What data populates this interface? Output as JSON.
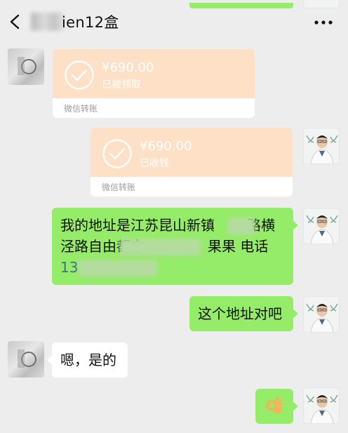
{
  "header": {
    "back_icon": "chevron-left-icon",
    "title": "ien12盒",
    "more_icon": "more-dots-icon"
  },
  "messages": [
    {
      "type": "transfer",
      "side": "left",
      "amount": "¥690.00",
      "status": "已被领取",
      "label": "微信转账"
    },
    {
      "type": "transfer",
      "side": "right",
      "amount": "¥690.00",
      "status": "已收钱",
      "label": "微信转账"
    },
    {
      "type": "text",
      "side": "right",
      "lines": [
        "我的地址是江苏昆山新镇",
        "泾路自由都市",
        "13"
      ],
      "line2_tail": "果果 电话",
      "line1_tail": "路横"
    },
    {
      "type": "text",
      "side": "right",
      "text": "这个地址对吧"
    },
    {
      "type": "text",
      "side": "left",
      "text": "嗯，是的"
    },
    {
      "type": "emoji",
      "side": "right",
      "emoji": "ok-hand-icon"
    }
  ],
  "colors": {
    "background": "#ededed",
    "sent_bubble": "#95ec69",
    "received_bubble": "#ffffff",
    "transfer_card": "#fde0c5"
  }
}
